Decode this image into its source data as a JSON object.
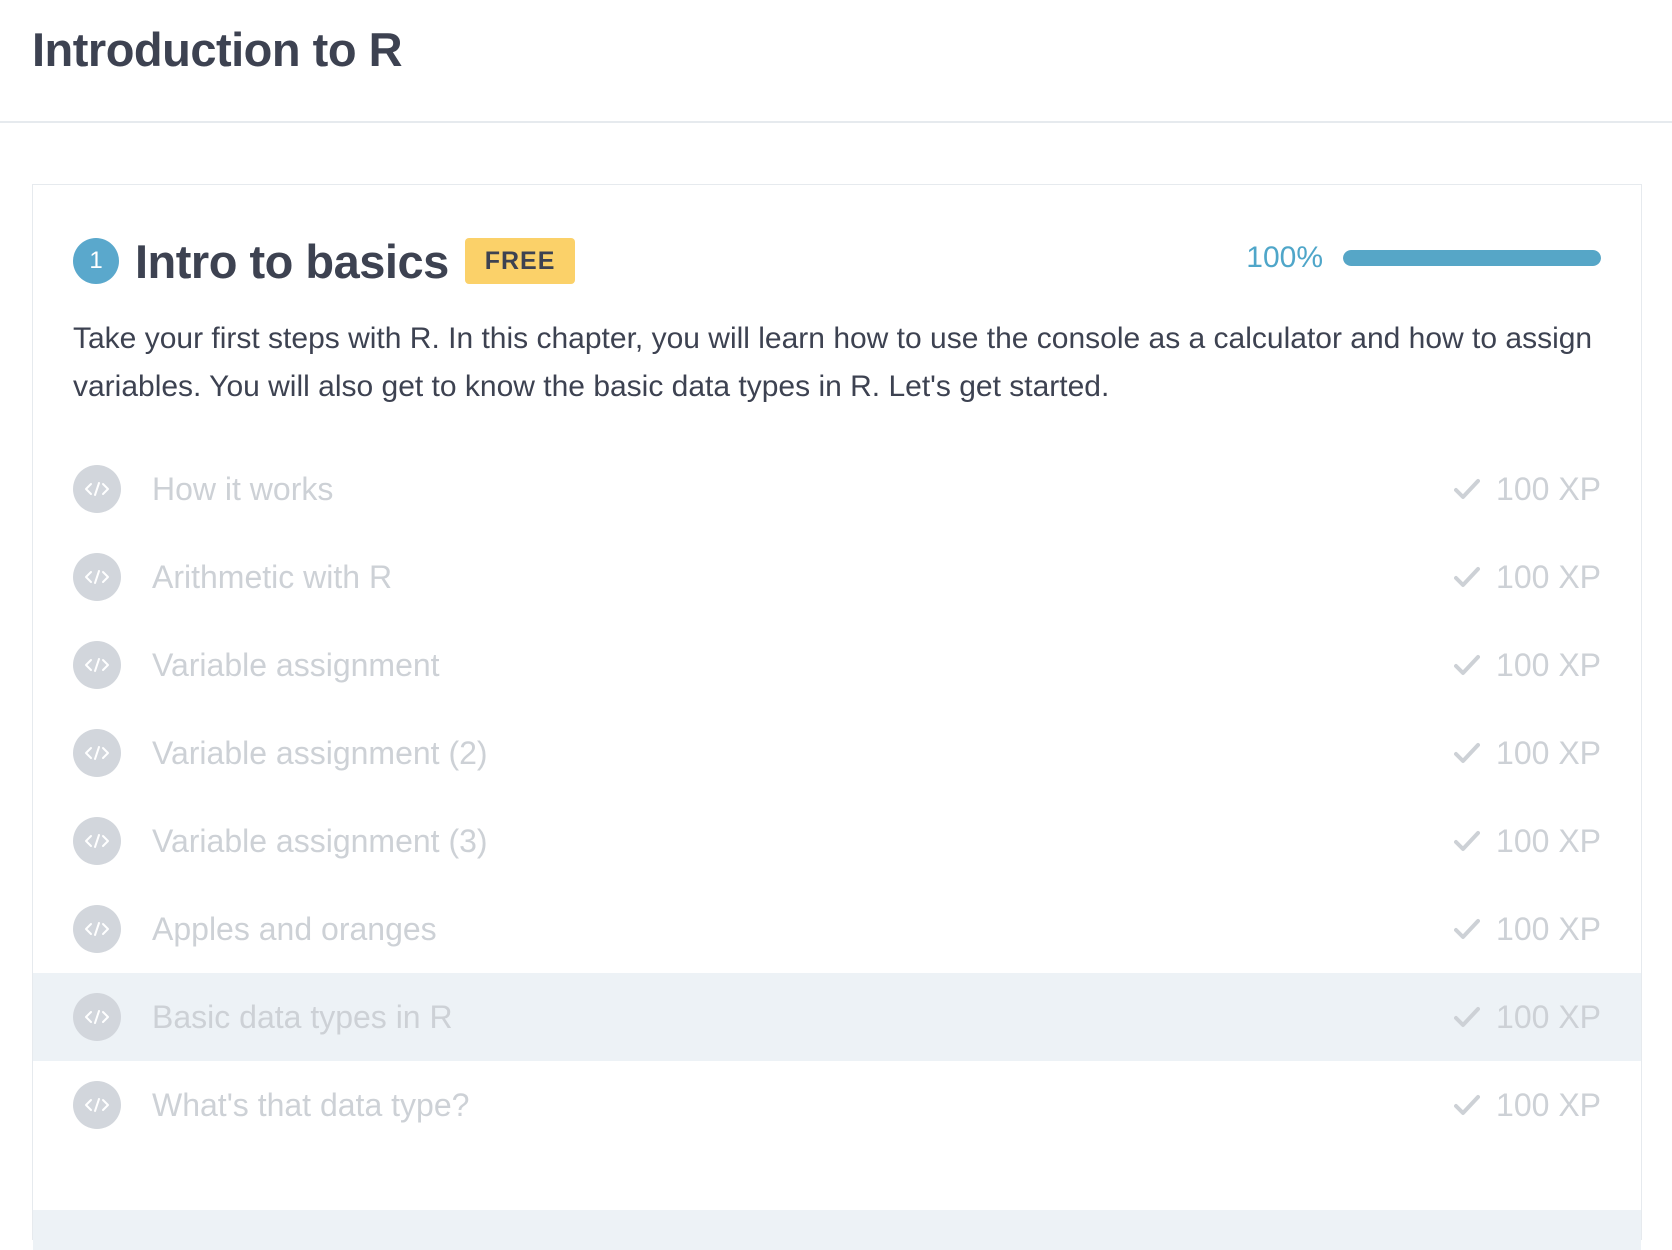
{
  "page": {
    "title": "Introduction to R"
  },
  "chapter": {
    "number": "1",
    "title": "Intro to basics",
    "badge": "FREE",
    "progress_label": "100%",
    "progress_value": 1.0,
    "description": "Take your first steps with R. In this chapter, you will learn how to use the console as a calculator and how to assign variables. You will also get to know the basic data types in R. Let's get started.",
    "exercises": [
      {
        "label": "How it works",
        "xp": "100 XP",
        "icon": "code-icon",
        "status_icon": "check-icon",
        "highlighted": false
      },
      {
        "label": "Arithmetic with R",
        "xp": "100 XP",
        "icon": "code-icon",
        "status_icon": "check-icon",
        "highlighted": false
      },
      {
        "label": "Variable assignment",
        "xp": "100 XP",
        "icon": "code-icon",
        "status_icon": "check-icon",
        "highlighted": false
      },
      {
        "label": "Variable assignment (2)",
        "xp": "100 XP",
        "icon": "code-icon",
        "status_icon": "check-icon",
        "highlighted": false
      },
      {
        "label": "Variable assignment (3)",
        "xp": "100 XP",
        "icon": "code-icon",
        "status_icon": "check-icon",
        "highlighted": false
      },
      {
        "label": "Apples and oranges",
        "xp": "100 XP",
        "icon": "code-icon",
        "status_icon": "check-icon",
        "highlighted": false
      },
      {
        "label": "Basic data types in R",
        "xp": "100 XP",
        "icon": "code-icon",
        "status_icon": "check-icon",
        "highlighted": true
      },
      {
        "label": "What's that data type?",
        "xp": "100 XP",
        "icon": "code-icon",
        "status_icon": "check-icon",
        "highlighted": false
      }
    ]
  },
  "colors": {
    "accent": "#56a6c7",
    "badge": "#fbd169",
    "text_dark": "#3d4251",
    "text_muted": "#cdd1d6",
    "icon_bg": "#d2d6dc",
    "highlight_bg": "#edf2f6"
  }
}
